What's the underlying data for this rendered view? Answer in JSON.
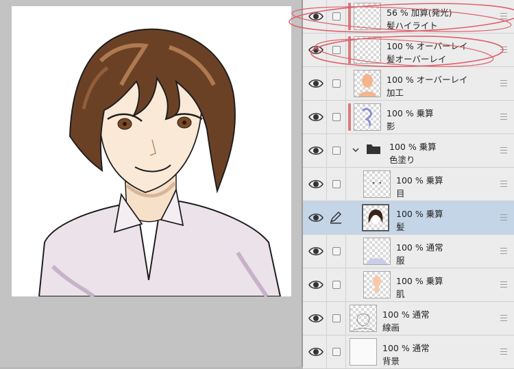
{
  "canvas": {
    "illustration": "anime-style young man with brown hair in light pink collared shirt"
  },
  "layers": [
    {
      "mode": "56 % 加算(発光)",
      "name": "髪ハイライト",
      "icon": "eye-icon",
      "checked": false,
      "clipped": true
    },
    {
      "mode": "100 % オーバーレイ",
      "name": "髪オーバーレイ",
      "icon": "eye-icon",
      "checked": false,
      "clipped": true
    },
    {
      "mode": "100 % オーバーレイ",
      "name": "加工",
      "icon": "eye-icon",
      "checked": false,
      "clipped": false
    },
    {
      "mode": "100 % 乗算",
      "name": "影",
      "icon": "eye-icon",
      "checked": false,
      "clipped": true
    },
    {
      "mode": "100 % 乗算",
      "name": "色塗り",
      "icon": "folder-icon",
      "checked": false,
      "clipped": false
    },
    {
      "mode": "100 % 乗算",
      "name": "目",
      "icon": "eye-icon",
      "checked": false,
      "clipped": false
    },
    {
      "mode": "100 % 乗算",
      "name": "髪",
      "icon": "pen-icon",
      "checked": false,
      "clipped": false,
      "selected": true
    },
    {
      "mode": "100 % 通常",
      "name": "服",
      "icon": "eye-icon",
      "checked": false,
      "clipped": false
    },
    {
      "mode": "100 % 乗算",
      "name": "肌",
      "icon": "eye-icon",
      "checked": false,
      "clipped": false
    },
    {
      "mode": "100 % 通常",
      "name": "線画",
      "icon": "eye-icon",
      "checked": false,
      "clipped": false
    },
    {
      "mode": "100 % 通常",
      "name": "背景",
      "icon": "eye-icon",
      "checked": false,
      "clipped": false
    }
  ],
  "colors": {
    "panel_bg": "#e9e9e9",
    "selected_row": "#c4d5e8",
    "clip_bar": "#d97b7b",
    "annotation": "#e0606a"
  }
}
